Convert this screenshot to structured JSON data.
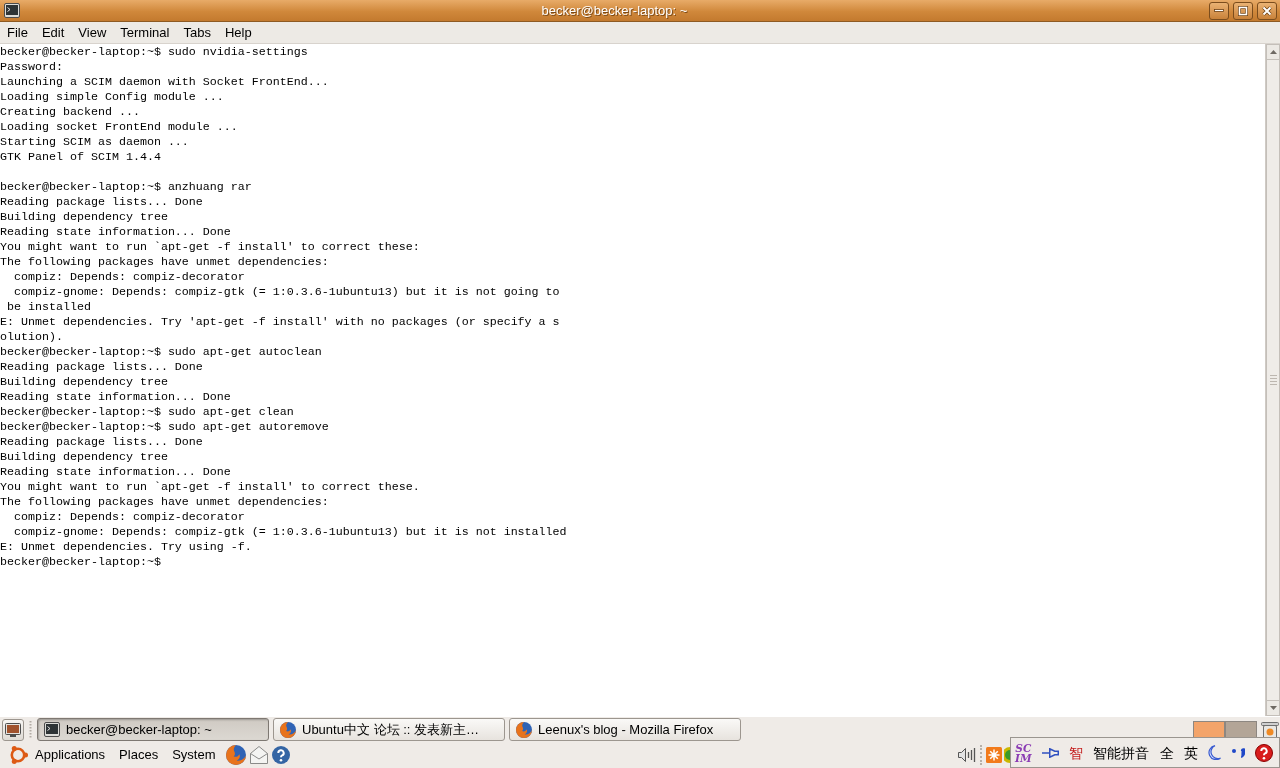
{
  "window": {
    "title": "becker@becker-laptop: ~"
  },
  "menu": [
    "File",
    "Edit",
    "View",
    "Terminal",
    "Tabs",
    "Help"
  ],
  "terminal": {
    "blocks": [
      {
        "lines": [
          "becker@becker-laptop:~$ sudo nvidia-settings",
          "Password:",
          "Launching a SCIM daemon with Socket FrontEnd...",
          "Loading simple Config module ...",
          "Creating backend ...",
          "Loading socket FrontEnd module ...",
          "Starting SCIM as daemon ...",
          "GTK Panel of SCIM 1.4.4"
        ]
      },
      {
        "lines": [
          "becker@becker-laptop:~$ anzhuang rar",
          "Reading package lists... Done",
          "Building dependency tree",
          "Reading state information... Done",
          "You might want to run `apt-get -f install' to correct these:",
          "The following packages have unmet dependencies:",
          "  compiz: Depends: compiz-decorator",
          "  compiz-gnome: Depends: compiz-gtk (= 1:0.3.6-1ubuntu13) but it is not going to",
          " be installed",
          "E: Unmet dependencies. Try 'apt-get -f install' with no packages (or specify a s",
          "olution).",
          "becker@becker-laptop:~$ sudo apt-get autoclean",
          "Reading package lists... Done",
          "Building dependency tree",
          "Reading state information... Done",
          "becker@becker-laptop:~$ sudo apt-get clean",
          "becker@becker-laptop:~$ sudo apt-get autoremove",
          "Reading package lists... Done",
          "Building dependency tree",
          "Reading state information... Done",
          "You might want to run `apt-get -f install' to correct these.",
          "The following packages have unmet dependencies:",
          "  compiz: Depends: compiz-decorator",
          "  compiz-gnome: Depends: compiz-gtk (= 1:0.3.6-1ubuntu13) but it is not installed",
          "E: Unmet dependencies. Try using -f.",
          "becker@becker-laptop:~$"
        ]
      }
    ]
  },
  "taskbar": {
    "tasks": [
      {
        "label": "becker@becker-laptop: ~",
        "kind": "terminal",
        "selected": true
      },
      {
        "label": "Ubuntu中文 论坛 :: 发表新主…",
        "kind": "browser",
        "selected": false
      },
      {
        "label": "Leenux's blog - Mozilla Firefox",
        "kind": "browser",
        "selected": false
      }
    ],
    "workspaces": [
      {
        "selected": true
      },
      {
        "selected": false
      }
    ]
  },
  "panel": {
    "menus": [
      "Applications",
      "Places",
      "System"
    ]
  },
  "input_method": {
    "logo": [
      "SC",
      "IM"
    ],
    "engine_glyph": "智",
    "engine": "智能拼音",
    "width_mode": "全",
    "language": "英"
  }
}
